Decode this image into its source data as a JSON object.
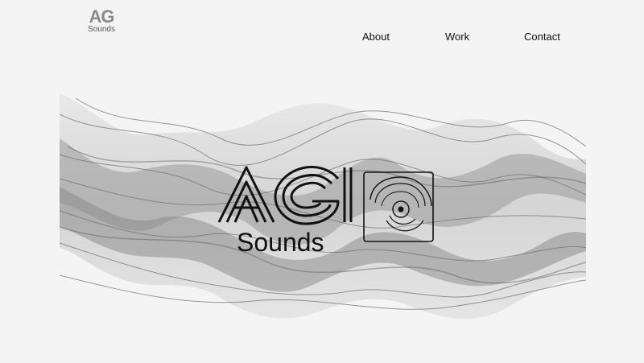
{
  "header": {
    "logo": {
      "mark": "AG",
      "subtitle": "Sounds"
    },
    "nav": [
      {
        "label": "About"
      },
      {
        "label": "Work"
      },
      {
        "label": "Contact"
      }
    ]
  },
  "hero": {
    "logo": {
      "mark": "AG",
      "subtitle": "Sounds"
    },
    "icon": "vinyl-record-icon"
  },
  "colors": {
    "background": "#f4f4f4",
    "wave": "#7a7a7a",
    "text": "#111111"
  }
}
